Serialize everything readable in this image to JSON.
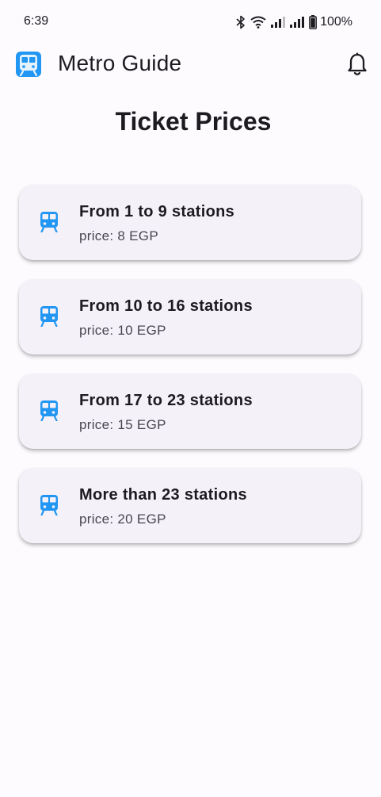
{
  "status_bar": {
    "time": "6:39",
    "battery": "100%"
  },
  "app_bar": {
    "title": "Metro Guide",
    "logo_icon": "metro-train-icon",
    "action_icon": "bell-icon"
  },
  "page": {
    "title": "Ticket Prices"
  },
  "prices": [
    {
      "title": "From 1 to 9 stations",
      "price": "price: 8 EGP",
      "icon": "train-icon"
    },
    {
      "title": "From 10 to 16 stations",
      "price": "price: 10 EGP",
      "icon": "train-icon"
    },
    {
      "title": "From 17 to 23 stations",
      "price": "price: 15 EGP",
      "icon": "train-icon"
    },
    {
      "title": "More than 23 stations",
      "price": "price: 20 EGP",
      "icon": "train-icon"
    }
  ],
  "colors": {
    "accent": "#2196f3",
    "card_background": "#f5f1f9",
    "background": "#fefbff"
  }
}
